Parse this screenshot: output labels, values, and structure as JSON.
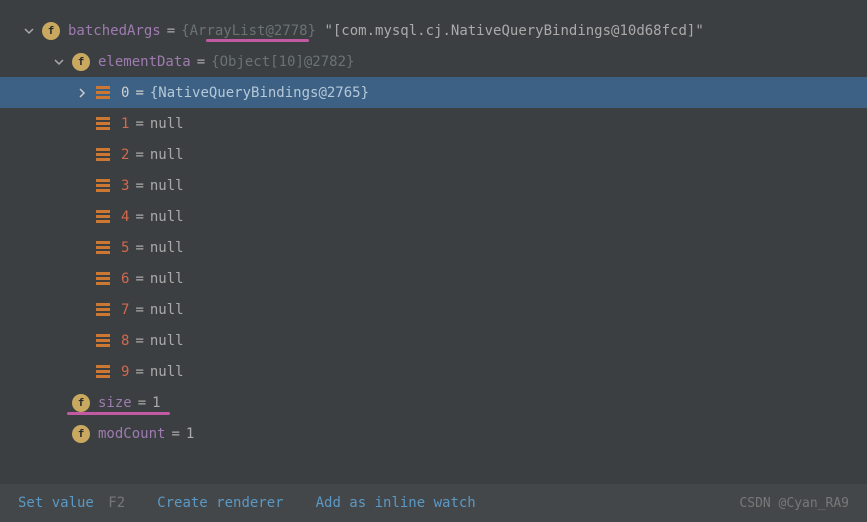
{
  "rows": {
    "batchedArgs": {
      "name": "batchedArgs",
      "ref": "{ArrayList@2778}",
      "value": "\"[com.mysql.cj.NativeQueryBindings@10d68fcd]\""
    },
    "elementData": {
      "name": "elementData",
      "ref": "{Object[10]@2782}"
    },
    "item0": {
      "index": "0",
      "value": "{NativeQueryBindings@2765}"
    },
    "nullItems": [
      {
        "index": "1",
        "value": "null"
      },
      {
        "index": "2",
        "value": "null"
      },
      {
        "index": "3",
        "value": "null"
      },
      {
        "index": "4",
        "value": "null"
      },
      {
        "index": "5",
        "value": "null"
      },
      {
        "index": "6",
        "value": "null"
      },
      {
        "index": "7",
        "value": "null"
      },
      {
        "index": "8",
        "value": "null"
      },
      {
        "index": "9",
        "value": "null"
      }
    ],
    "size": {
      "name": "size",
      "value": "1"
    },
    "modCount": {
      "name": "modCount",
      "value": "1"
    }
  },
  "footer": {
    "setValue": "Set value",
    "setValueKey": "F2",
    "createRenderer": "Create renderer",
    "addInlineWatch": "Add as inline watch",
    "watermark": "CSDN @Cyan_RA9"
  }
}
